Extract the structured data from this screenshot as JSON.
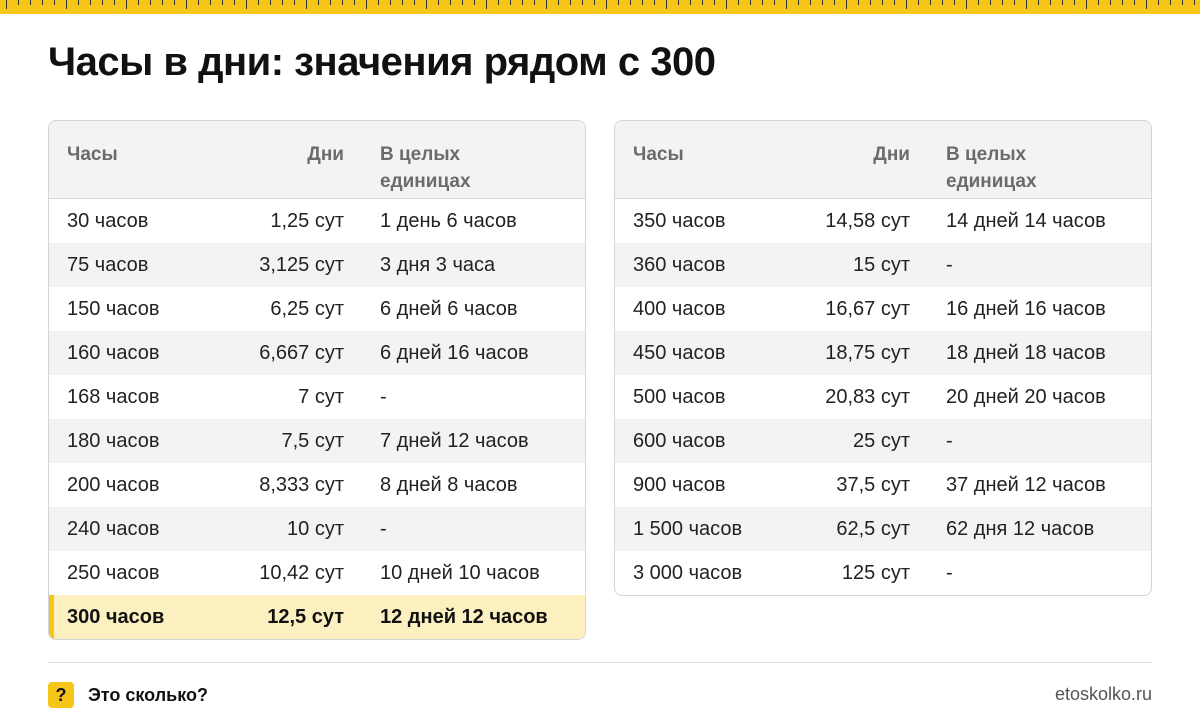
{
  "page": {
    "title": "Часы в дни: значения рядом с 300",
    "accent_color": "#f5c518"
  },
  "table_left": {
    "headers": [
      "Часы",
      "Дни",
      "В целых единицах"
    ],
    "rows": [
      [
        "30 часов",
        "1,25 сут",
        "1 день 6 часов"
      ],
      [
        "75 часов",
        "3,125 сут",
        "3 дня 3 часа"
      ],
      [
        "150 часов",
        "6,25 сут",
        "6 дней 6 часов"
      ],
      [
        "160 часов",
        "6,667 сут",
        "6 дней 16 часов"
      ],
      [
        "168 часов",
        "7 сут",
        "-"
      ],
      [
        "180 часов",
        "7,5 сут",
        "7 дней 12 часов"
      ],
      [
        "200 часов",
        "8,333 сут",
        "8 дней 8 часов"
      ],
      [
        "240 часов",
        "10 сут",
        "-"
      ],
      [
        "250 часов",
        "10,42 сут",
        "10 дней 10 часов"
      ],
      [
        "300 часов",
        "12,5 сут",
        "12 дней 12 часов"
      ]
    ],
    "highlighted_row": 9
  },
  "table_right": {
    "headers": [
      "Часы",
      "Дни",
      "В целых единицах"
    ],
    "rows": [
      [
        "350 часов",
        "14,58 сут",
        "14 дней 14 часов"
      ],
      [
        "360 часов",
        "15 сут",
        "-"
      ],
      [
        "400 часов",
        "16,67 сут",
        "16 дней 16 часов"
      ],
      [
        "450 часов",
        "18,75 сут",
        "18 дней 18 часов"
      ],
      [
        "500 часов",
        "20,83 сут",
        "20 дней 20 часов"
      ],
      [
        "600 часов",
        "25 сут",
        "-"
      ],
      [
        "900 часов",
        "37,5 сут",
        "37 дней 12 часов"
      ],
      [
        "1 500 часов",
        "62,5 сут",
        "62 дня 12 часов"
      ],
      [
        "3 000 часов",
        "125 сут",
        "-"
      ]
    ]
  },
  "footer": {
    "icon_glyph": "?",
    "brand": "Это сколько?",
    "site": "etoskolko.ru"
  }
}
